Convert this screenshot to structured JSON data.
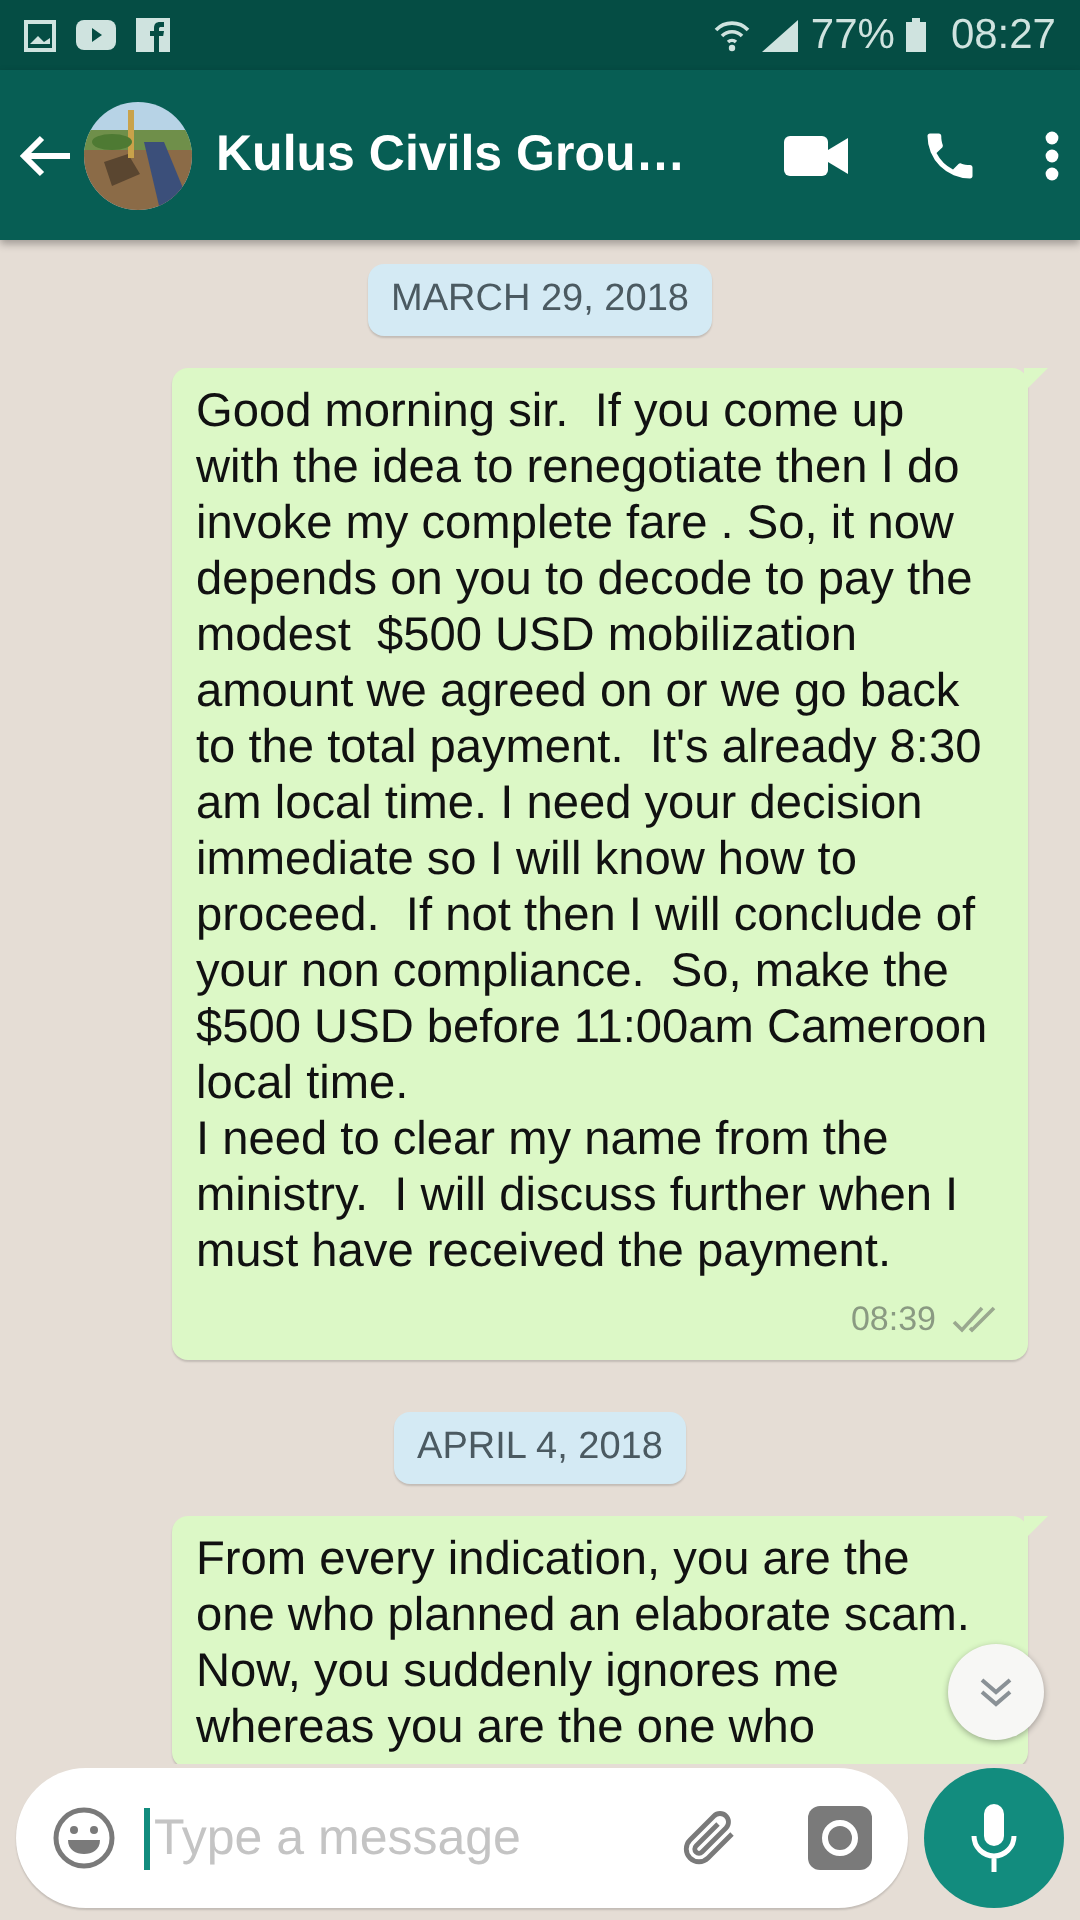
{
  "status_bar": {
    "battery": "77%",
    "time": "08:27"
  },
  "header": {
    "title": "Kulus Civils Grou…"
  },
  "messages": [
    {
      "kind": "date",
      "text": "MARCH 29, 2018"
    },
    {
      "kind": "outgoing",
      "text": "Good morning sir.  If you come up with the idea to renegotiate then I do invoke my complete fare . So, it now depends on you to decode to pay the modest  $500 USD mobilization amount we agreed on or we go back to the total payment.  It's already 8:30 am local time. I need your decision immediate so I will know how to proceed.  If not then I will conclude of your non compliance.  So, make the $500 USD before 11:00am Cameroon local time.\nI need to clear my name from the ministry.  I will discuss further when I must have received the payment.",
      "time": "08:39"
    },
    {
      "kind": "date",
      "text": "APRIL 4, 2018"
    },
    {
      "kind": "outgoing",
      "text": "From every indication, you are the one who planned an elaborate scam. Now, you suddenly ignores me whereas you are the one who"
    }
  ],
  "composer": {
    "placeholder": "Type a message"
  }
}
